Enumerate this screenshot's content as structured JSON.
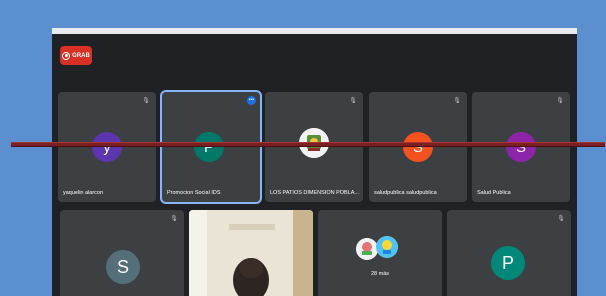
{
  "recording": {
    "label": "GRAB",
    "color": "#d93025"
  },
  "tiles_row1": [
    {
      "name": "yaquelin alarcon",
      "initial": "y",
      "color": "#5e35b1",
      "muted": true
    },
    {
      "name": "Promocion Social IDS",
      "initial": "P",
      "color": "#00796b",
      "muted": false,
      "speaking": true
    },
    {
      "name": "LOS PATIOS DIMENSION POBLA...",
      "initial": "",
      "color": "",
      "muted": true
    },
    {
      "name": "saludpublica saludpublica",
      "initial": "S",
      "color": "#f4511e",
      "muted": true
    },
    {
      "name": "Salud Publica",
      "initial": "S",
      "color": "#8e24aa",
      "muted": true
    }
  ],
  "tiles_row2": [
    {
      "name": "",
      "initial": "S",
      "color": "#546e7a",
      "muted": true
    },
    {
      "name": "",
      "initial": "",
      "color": "",
      "muted": false
    },
    {
      "more_label": "28 más"
    },
    {
      "name": "",
      "initial": "P",
      "color": "#00897b",
      "muted": true
    }
  ],
  "icons": {
    "mic_off": "mic-off-icon",
    "speaking": "audio-wave-icon",
    "record": "record-icon"
  }
}
